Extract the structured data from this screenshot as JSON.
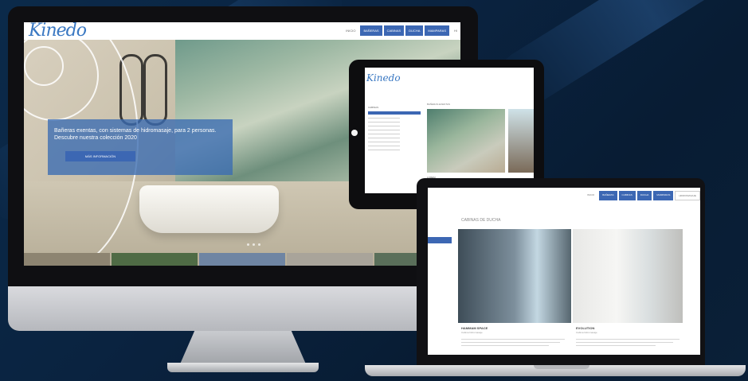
{
  "colors": {
    "accent": "#3c67b3",
    "logo": "#3a78c2",
    "background": "#0a2340"
  },
  "desktop": {
    "logo": "Kinedo",
    "nav": [
      {
        "label": "INICIO",
        "active": false
      },
      {
        "label": "BAÑERAS",
        "active": true
      },
      {
        "label": "CABINAS",
        "active": true
      },
      {
        "label": "DUCHA",
        "active": true
      },
      {
        "label": "MAMPARAS",
        "active": true
      },
      {
        "label": "HI",
        "active": false
      }
    ],
    "hero_text": "Bañeras exentas, con sistemas de hidromasaje, para 2 personas. Descubre nuestra colección 2020",
    "hero_button": "MÁS INFORMACIÓN"
  },
  "tablet": {
    "logo": "Kinedo",
    "section_label": "BAÑERAS EXENTAS",
    "sidebar_header": "CABINAS",
    "product_label": "LOREM"
  },
  "laptop": {
    "nav": [
      {
        "label": "INICIO",
        "style": "plain"
      },
      {
        "label": "BAÑERAS",
        "style": "on"
      },
      {
        "label": "CABINAS",
        "style": "on"
      },
      {
        "label": "DUCHA",
        "style": "on"
      },
      {
        "label": "MAMPARAS",
        "style": "on"
      },
      {
        "label": "HIDROMASAJE",
        "style": "out"
      }
    ],
    "section_title": "CABINAS DE DUCHA",
    "products": [
      {
        "name": "HAMMAM SPACE",
        "subtitle": "Cabina hidromasaje"
      },
      {
        "name": "EVOLUTION",
        "subtitle": "Cabina hidromasaje"
      }
    ]
  }
}
